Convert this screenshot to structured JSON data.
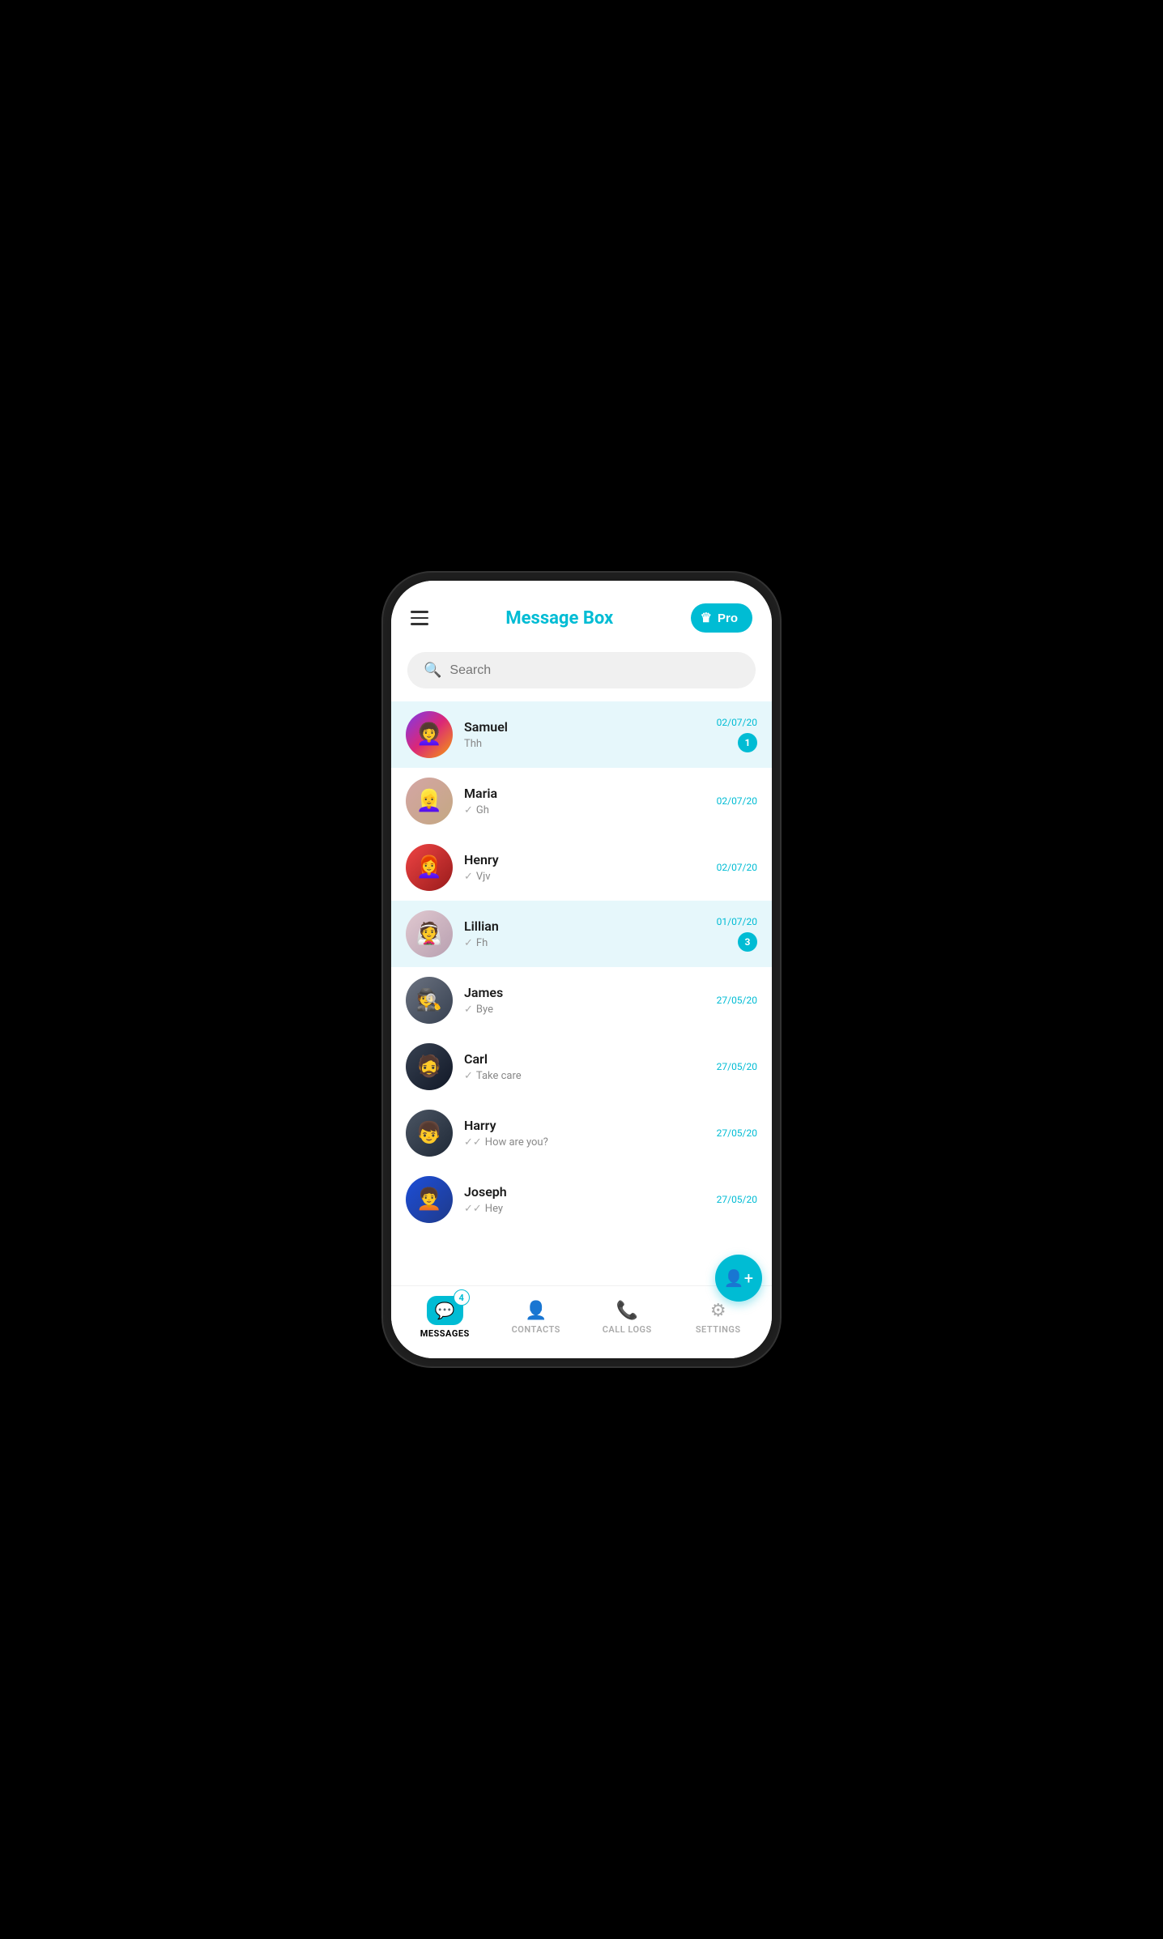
{
  "header": {
    "title": "Message Box",
    "pro_label": "Pro"
  },
  "search": {
    "placeholder": "Search"
  },
  "messages": [
    {
      "id": "samuel",
      "name": "Samuel",
      "preview": "Thh",
      "check": "none",
      "date": "02/07/20",
      "unread": 1,
      "highlighted": true,
      "avatar_emoji": "👩‍🦱"
    },
    {
      "id": "maria",
      "name": "Maria",
      "preview": "Gh",
      "check": "single",
      "date": "02/07/20",
      "unread": 0,
      "highlighted": false,
      "avatar_emoji": "👩‍🦳"
    },
    {
      "id": "henry",
      "name": "Henry",
      "preview": "Vjv",
      "check": "single",
      "date": "02/07/20",
      "unread": 0,
      "highlighted": false,
      "avatar_emoji": "👩‍🦰"
    },
    {
      "id": "lillian",
      "name": "Lillian",
      "preview": "Fh",
      "check": "single",
      "date": "01/07/20",
      "unread": 3,
      "highlighted": true,
      "avatar_emoji": "👰"
    },
    {
      "id": "james",
      "name": "James",
      "preview": "Bye",
      "check": "single",
      "date": "27/05/20",
      "unread": 0,
      "highlighted": false,
      "avatar_emoji": "🕵️"
    },
    {
      "id": "carl",
      "name": "Carl",
      "preview": "Take care",
      "check": "single",
      "date": "27/05/20",
      "unread": 0,
      "highlighted": false,
      "avatar_emoji": "🧔"
    },
    {
      "id": "harry",
      "name": "Harry",
      "preview": "How are you?",
      "check": "double",
      "date": "27/05/20",
      "unread": 0,
      "highlighted": false,
      "avatar_emoji": "👦"
    },
    {
      "id": "joseph",
      "name": "Joseph",
      "preview": "Hey",
      "check": "double",
      "date": "27/05/20",
      "unread": 0,
      "highlighted": false,
      "avatar_emoji": "🧑‍🦱"
    }
  ],
  "bottomNav": {
    "items": [
      {
        "id": "messages",
        "label": "MESSAGES",
        "active": true,
        "badge": 4
      },
      {
        "id": "contacts",
        "label": "CONTACTS",
        "active": false,
        "badge": 0
      },
      {
        "id": "call_logs",
        "label": "CALL LOGS",
        "active": false,
        "badge": 0
      },
      {
        "id": "settings",
        "label": "SETTINGS",
        "active": false,
        "badge": 0
      }
    ]
  }
}
